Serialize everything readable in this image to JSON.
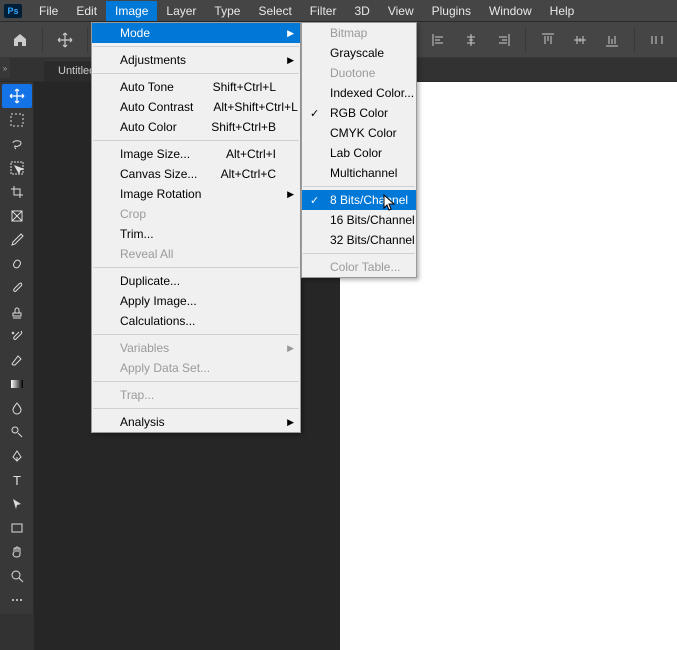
{
  "menubar": {
    "items": [
      "File",
      "Edit",
      "Image",
      "Layer",
      "Type",
      "Select",
      "Filter",
      "3D",
      "View",
      "Plugins",
      "Window",
      "Help"
    ],
    "active_index": 2
  },
  "tab": {
    "title": "Untitled"
  },
  "image_menu": {
    "rows": [
      {
        "label": "Mode",
        "arrow": true,
        "hl": true
      },
      {
        "sep": true
      },
      {
        "label": "Adjustments",
        "arrow": true
      },
      {
        "sep": true
      },
      {
        "label": "Auto Tone",
        "shortcut": "Shift+Ctrl+L"
      },
      {
        "label": "Auto Contrast",
        "shortcut": "Alt+Shift+Ctrl+L"
      },
      {
        "label": "Auto Color",
        "shortcut": "Shift+Ctrl+B"
      },
      {
        "sep": true
      },
      {
        "label": "Image Size...",
        "shortcut": "Alt+Ctrl+I"
      },
      {
        "label": "Canvas Size...",
        "shortcut": "Alt+Ctrl+C"
      },
      {
        "label": "Image Rotation",
        "arrow": true
      },
      {
        "label": "Crop",
        "disabled": true
      },
      {
        "label": "Trim..."
      },
      {
        "label": "Reveal All",
        "disabled": true
      },
      {
        "sep": true
      },
      {
        "label": "Duplicate..."
      },
      {
        "label": "Apply Image..."
      },
      {
        "label": "Calculations..."
      },
      {
        "sep": true
      },
      {
        "label": "Variables",
        "arrow": true,
        "disabled": true
      },
      {
        "label": "Apply Data Set...",
        "disabled": true
      },
      {
        "sep": true
      },
      {
        "label": "Trap...",
        "disabled": true
      },
      {
        "sep": true
      },
      {
        "label": "Analysis",
        "arrow": true
      }
    ]
  },
  "mode_menu": {
    "rows": [
      {
        "label": "Bitmap",
        "disabled": true
      },
      {
        "label": "Grayscale"
      },
      {
        "label": "Duotone",
        "disabled": true
      },
      {
        "label": "Indexed Color..."
      },
      {
        "label": "RGB Color",
        "check": true
      },
      {
        "label": "CMYK Color"
      },
      {
        "label": "Lab Color"
      },
      {
        "label": "Multichannel"
      },
      {
        "sep": true
      },
      {
        "label": "8 Bits/Channel",
        "check": true,
        "hl": true
      },
      {
        "label": "16 Bits/Channel"
      },
      {
        "label": "32 Bits/Channel"
      },
      {
        "sep": true
      },
      {
        "label": "Color Table...",
        "disabled": true
      }
    ]
  }
}
